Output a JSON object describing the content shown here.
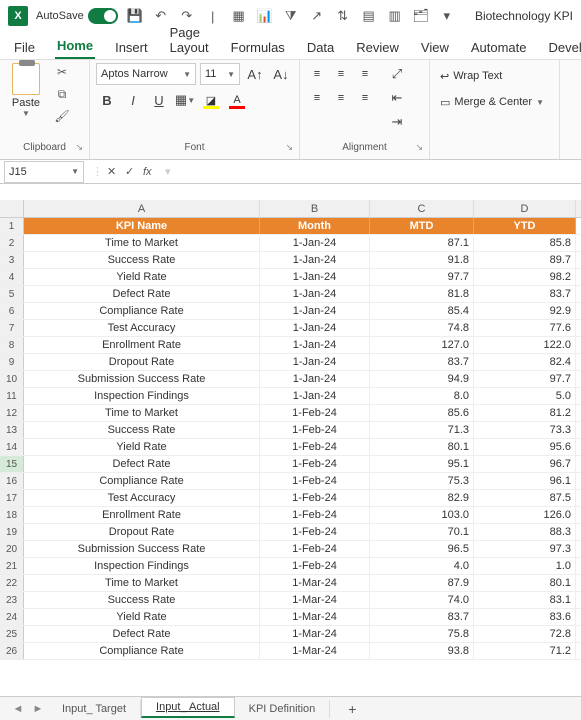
{
  "titlebar": {
    "autosave_label": "AutoSave",
    "doc_name": "Biotechnology KPI"
  },
  "tabs": {
    "file": "File",
    "home": "Home",
    "insert": "Insert",
    "pagelayout": "Page Layout",
    "formulas": "Formulas",
    "data": "Data",
    "review": "Review",
    "view": "View",
    "automate": "Automate",
    "developer": "Develope"
  },
  "ribbon": {
    "paste": "Paste",
    "clipboard": "Clipboard",
    "font_name": "Aptos Narrow",
    "font_size": "11",
    "font_group": "Font",
    "alignment": "Alignment",
    "wrap": "Wrap Text",
    "merge": "Merge & Center"
  },
  "namebox": "J15",
  "fx": "fx",
  "columns": [
    "A",
    "B",
    "C",
    "D"
  ],
  "headers": {
    "a": "KPI Name",
    "b": "Month",
    "c": "MTD",
    "d": "YTD"
  },
  "rows": [
    {
      "n": "2",
      "a": "Time to Market",
      "b": "1-Jan-24",
      "c": "87.1",
      "d": "85.8"
    },
    {
      "n": "3",
      "a": "Success Rate",
      "b": "1-Jan-24",
      "c": "91.8",
      "d": "89.7"
    },
    {
      "n": "4",
      "a": "Yield Rate",
      "b": "1-Jan-24",
      "c": "97.7",
      "d": "98.2"
    },
    {
      "n": "5",
      "a": "Defect Rate",
      "b": "1-Jan-24",
      "c": "81.8",
      "d": "83.7"
    },
    {
      "n": "6",
      "a": "Compliance Rate",
      "b": "1-Jan-24",
      "c": "85.4",
      "d": "92.9"
    },
    {
      "n": "7",
      "a": "Test Accuracy",
      "b": "1-Jan-24",
      "c": "74.8",
      "d": "77.6"
    },
    {
      "n": "8",
      "a": "Enrollment Rate",
      "b": "1-Jan-24",
      "c": "127.0",
      "d": "122.0"
    },
    {
      "n": "9",
      "a": "Dropout Rate",
      "b": "1-Jan-24",
      "c": "83.7",
      "d": "82.4"
    },
    {
      "n": "10",
      "a": "Submission Success Rate",
      "b": "1-Jan-24",
      "c": "94.9",
      "d": "97.7"
    },
    {
      "n": "11",
      "a": "Inspection Findings",
      "b": "1-Jan-24",
      "c": "8.0",
      "d": "5.0"
    },
    {
      "n": "12",
      "a": "Time to Market",
      "b": "1-Feb-24",
      "c": "85.6",
      "d": "81.2"
    },
    {
      "n": "13",
      "a": "Success Rate",
      "b": "1-Feb-24",
      "c": "71.3",
      "d": "73.3"
    },
    {
      "n": "14",
      "a": "Yield Rate",
      "b": "1-Feb-24",
      "c": "80.1",
      "d": "95.6"
    },
    {
      "n": "15",
      "a": "Defect Rate",
      "b": "1-Feb-24",
      "c": "95.1",
      "d": "96.7"
    },
    {
      "n": "16",
      "a": "Compliance Rate",
      "b": "1-Feb-24",
      "c": "75.3",
      "d": "96.1"
    },
    {
      "n": "17",
      "a": "Test Accuracy",
      "b": "1-Feb-24",
      "c": "82.9",
      "d": "87.5"
    },
    {
      "n": "18",
      "a": "Enrollment Rate",
      "b": "1-Feb-24",
      "c": "103.0",
      "d": "126.0"
    },
    {
      "n": "19",
      "a": "Dropout Rate",
      "b": "1-Feb-24",
      "c": "70.1",
      "d": "88.3"
    },
    {
      "n": "20",
      "a": "Submission Success Rate",
      "b": "1-Feb-24",
      "c": "96.5",
      "d": "97.3"
    },
    {
      "n": "21",
      "a": "Inspection Findings",
      "b": "1-Feb-24",
      "c": "4.0",
      "d": "1.0"
    },
    {
      "n": "22",
      "a": "Time to Market",
      "b": "1-Mar-24",
      "c": "87.9",
      "d": "80.1"
    },
    {
      "n": "23",
      "a": "Success Rate",
      "b": "1-Mar-24",
      "c": "74.0",
      "d": "83.1"
    },
    {
      "n": "24",
      "a": "Yield Rate",
      "b": "1-Mar-24",
      "c": "83.7",
      "d": "83.6"
    },
    {
      "n": "25",
      "a": "Defect Rate",
      "b": "1-Mar-24",
      "c": "75.8",
      "d": "72.8"
    },
    {
      "n": "26",
      "a": "Compliance Rate",
      "b": "1-Mar-24",
      "c": "93.8",
      "d": "71.2"
    }
  ],
  "sheets": {
    "s1": "Input_ Target",
    "s2": "Input_ Actual",
    "s3": "KPI Definition"
  }
}
